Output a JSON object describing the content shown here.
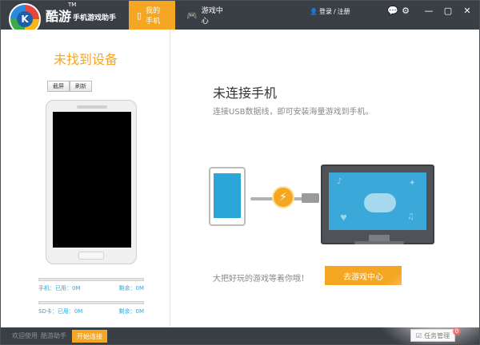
{
  "header": {
    "app_name": "酷游",
    "app_tm": "TM",
    "app_subtitle": "手机游戏助手",
    "tabs": [
      {
        "label": "我的手机"
      },
      {
        "label": "游戏中心"
      }
    ],
    "login": "登录",
    "register": "注册",
    "login_sep": "/"
  },
  "left_panel": {
    "title": "未找到设备",
    "screenshot_label": "截屏",
    "refresh_label": "刷新",
    "storage": [
      {
        "label": "手机：已用：0M",
        "remain": "剩余：0M"
      },
      {
        "label": "SD卡：已用：0M",
        "remain": "剩余：0M"
      }
    ]
  },
  "main": {
    "title": "未连接手机",
    "subtitle": "连接USB数据线，即可安装海量游戏到手机。",
    "tagline": "大把好玩的游戏等着你哦！",
    "cta_label": "去游戏中心"
  },
  "bottom_bar": {
    "welcome": "欢迎使用",
    "app": "酷游助手",
    "start_label": "开始连接",
    "task_label": "任务管理",
    "task_badge": "0"
  },
  "colors": {
    "accent": "#f5a623",
    "titlebar": "#3a3f45",
    "usb_blue": "#3aa8d9"
  }
}
